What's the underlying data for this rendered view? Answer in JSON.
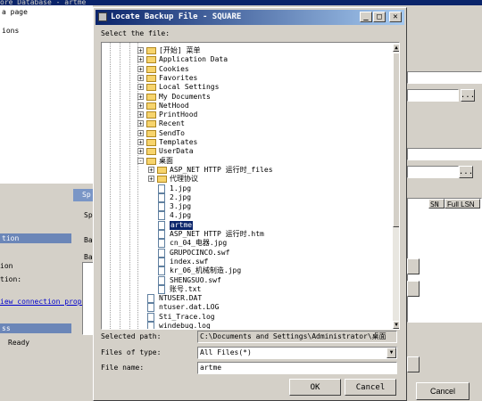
{
  "background": {
    "title_fragment": "ore Database - artme",
    "left_pane": {
      "items": [
        "a page",
        "ions"
      ]
    },
    "side_sections": [
      "tion",
      "ion",
      "tion:",
      "iew connection proper",
      "ss",
      "Ready"
    ],
    "sub_dialog": {
      "title": "Sp",
      "labels": [
        "Spe",
        "Ba",
        "Ba"
      ]
    },
    "right_grid": {
      "headers": [
        "SN",
        "Full LSN"
      ]
    },
    "cancel_label": "Cancel",
    "ellipsis": "..."
  },
  "dialog": {
    "title": "Locate Backup File - SQUARE",
    "select_label": "Select the file:",
    "tree": [
      {
        "label": "[开始] 菜单",
        "kind": "folder",
        "depth": 3,
        "expander": "+"
      },
      {
        "label": "Application Data",
        "kind": "folder",
        "depth": 3,
        "expander": "+"
      },
      {
        "label": "Cookies",
        "kind": "folder",
        "depth": 3,
        "expander": "+"
      },
      {
        "label": "Favorites",
        "kind": "folder",
        "depth": 3,
        "expander": "+"
      },
      {
        "label": "Local Settings",
        "kind": "folder",
        "depth": 3,
        "expander": "+"
      },
      {
        "label": "My Documents",
        "kind": "folder",
        "depth": 3,
        "expander": "+"
      },
      {
        "label": "NetHood",
        "kind": "folder",
        "depth": 3,
        "expander": "+"
      },
      {
        "label": "PrintHood",
        "kind": "folder",
        "depth": 3,
        "expander": "+"
      },
      {
        "label": "Recent",
        "kind": "folder",
        "depth": 3,
        "expander": "+"
      },
      {
        "label": "SendTo",
        "kind": "folder",
        "depth": 3,
        "expander": "+"
      },
      {
        "label": "Templates",
        "kind": "folder",
        "depth": 3,
        "expander": "+"
      },
      {
        "label": "UserData",
        "kind": "folder",
        "depth": 3,
        "expander": "+"
      },
      {
        "label": "桌面",
        "kind": "folder",
        "depth": 3,
        "expander": "-"
      },
      {
        "label": "ASP_NET HTTP 运行时_files",
        "kind": "folder",
        "depth": 4,
        "expander": "+"
      },
      {
        "label": "代理协议",
        "kind": "folder",
        "depth": 4,
        "expander": "+"
      },
      {
        "label": "1.jpg",
        "kind": "file",
        "depth": 4
      },
      {
        "label": "2.jpg",
        "kind": "file",
        "depth": 4
      },
      {
        "label": "3.jpg",
        "kind": "file",
        "depth": 4
      },
      {
        "label": "4.jpg",
        "kind": "file",
        "depth": 4
      },
      {
        "label": "artme",
        "kind": "file",
        "depth": 4,
        "selected": true
      },
      {
        "label": "ASP_NET HTTP 运行时.htm",
        "kind": "file",
        "depth": 4
      },
      {
        "label": "cn_04_电器.jpg",
        "kind": "file",
        "depth": 4
      },
      {
        "label": "GRUPOCINCO.swf",
        "kind": "file",
        "depth": 4
      },
      {
        "label": "index.swf",
        "kind": "file",
        "depth": 4
      },
      {
        "label": "kr_06_机械制造.jpg",
        "kind": "file",
        "depth": 4
      },
      {
        "label": "SHENGSUO.swf",
        "kind": "file",
        "depth": 4
      },
      {
        "label": "账号.txt",
        "kind": "file",
        "depth": 4
      },
      {
        "label": "NTUSER.DAT",
        "kind": "file",
        "depth": 2
      },
      {
        "label": "ntuser.dat.LOG",
        "kind": "file",
        "depth": 2
      },
      {
        "label": "Sti_Trace.log",
        "kind": "file",
        "depth": 2
      },
      {
        "label": "windebug.log",
        "kind": "file",
        "depth": 2
      }
    ],
    "selected_path_label": "Selected path:",
    "selected_path_value": "C:\\Documents and Settings\\Administrator\\桌面",
    "files_of_type_label": "Files of type:",
    "files_of_type_value": "All Files(*)",
    "file_name_label": "File name:",
    "file_name_value": "artme",
    "ok_label": "OK",
    "cancel_label": "Cancel"
  },
  "colors": {
    "titlebar": "#0a246a",
    "selection": "#0a246a",
    "chrome": "#d4d0c8"
  }
}
